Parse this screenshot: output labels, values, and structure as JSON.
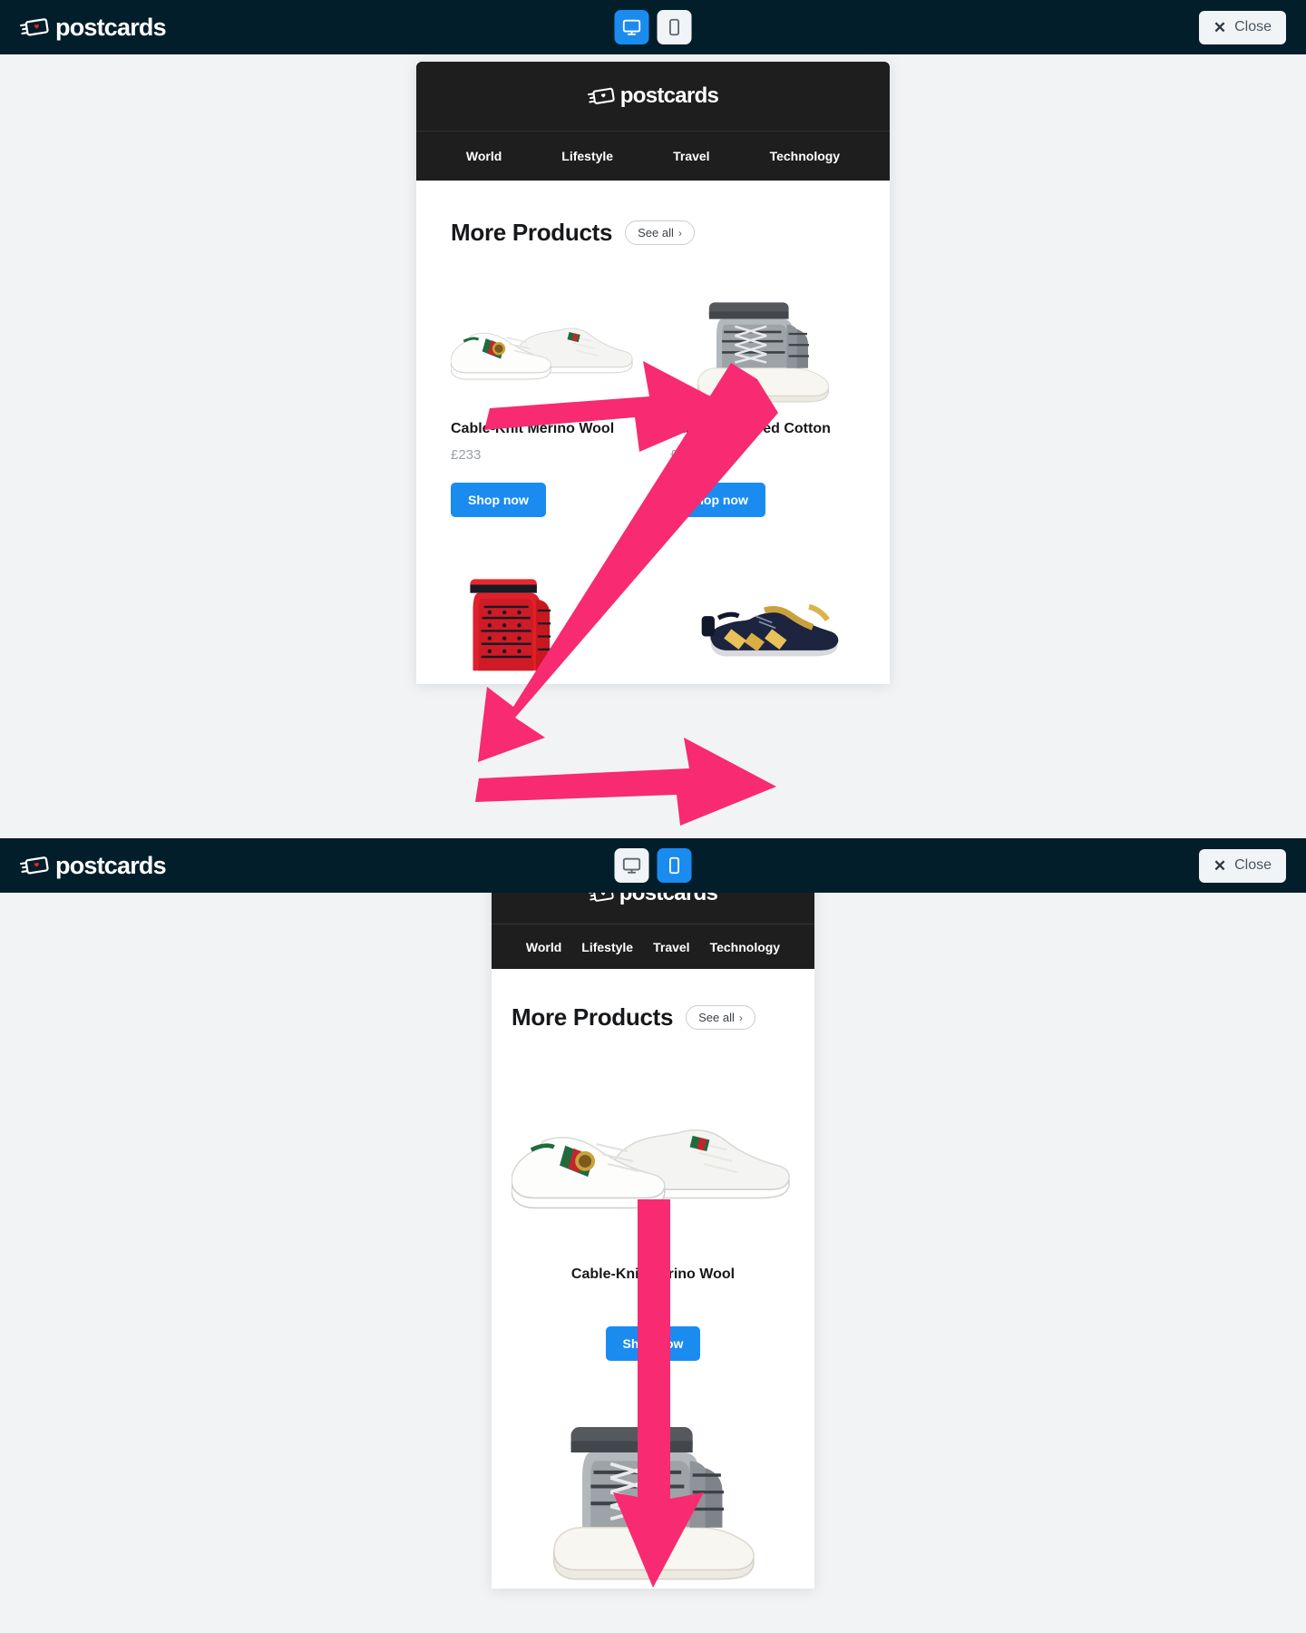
{
  "brand": {
    "name": "postcards",
    "logo_icon": "postcard-heart-icon",
    "accent_color": "#e8242a"
  },
  "toolbar": {
    "desktop_icon": "desktop-monitor-icon",
    "mobile_icon": "mobile-phone-icon",
    "close_label": "Close",
    "close_icon": "close-x-icon",
    "background_color": "#031e2b",
    "active_color": "#1a8cf0"
  },
  "previews": [
    {
      "id": "desktop",
      "active_device": "desktop"
    },
    {
      "id": "mobile",
      "active_device": "mobile"
    }
  ],
  "email": {
    "header": {
      "logo_text": "postcards",
      "background_color": "#1e1e1e"
    },
    "nav": [
      {
        "label": "World"
      },
      {
        "label": "Lifestyle"
      },
      {
        "label": "Travel"
      },
      {
        "label": "Technology"
      }
    ],
    "section": {
      "title": "More Products",
      "see_all_label": "See all",
      "see_all_chevron": "›"
    },
    "products": [
      {
        "name": "Cable-Knit Merino Wool",
        "price": "£233",
        "cta": "Shop now",
        "image": "white-low-top-sneaker"
      },
      {
        "name": "Runway Striped Cotton",
        "price": "£246",
        "cta": "Shop now",
        "image": "grey-high-top-sneaker"
      },
      {
        "name": "",
        "price": "",
        "cta": "",
        "image": "red-high-top-boot"
      },
      {
        "name": "",
        "price": "",
        "cta": "",
        "image": "navy-gold-sneaker"
      }
    ],
    "cta_color": "#1a8cf0"
  },
  "annotations": {
    "color": "#f72a72",
    "arrows": [
      {
        "name": "arrow-white-to-grey-sneaker",
        "direction": "right"
      },
      {
        "name": "arrow-grey-sneaker-to-red-boot",
        "direction": "down-left"
      },
      {
        "name": "arrow-red-boot-to-navy-sneaker",
        "direction": "right"
      },
      {
        "name": "arrow-mobile-white-to-grey-sneaker",
        "direction": "down"
      }
    ]
  }
}
